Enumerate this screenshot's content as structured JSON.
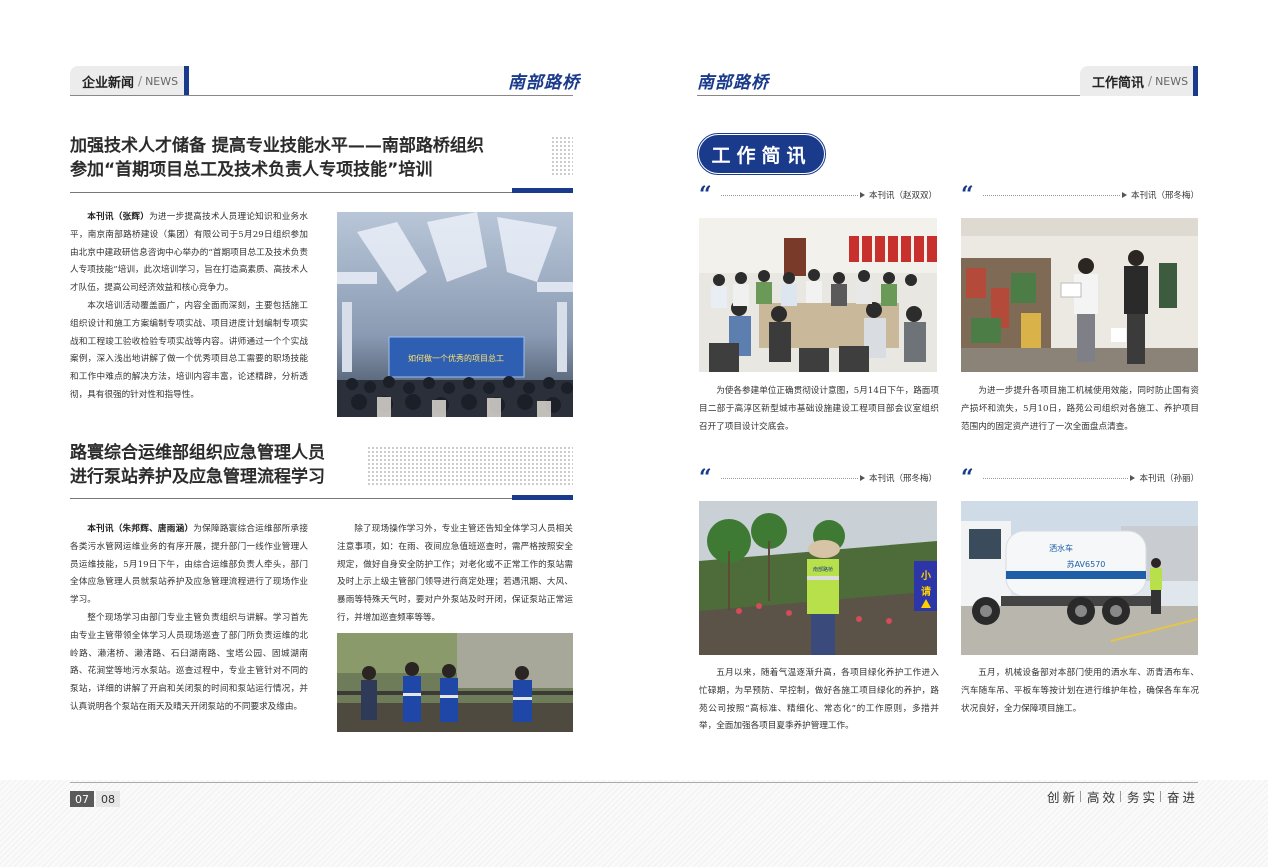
{
  "left": {
    "section": {
      "cn": "企业新闻",
      "slash": "/",
      "en": "NEWS"
    },
    "logo": "南部路桥",
    "article1": {
      "title_line1": "加强技术人才储备 提高专业技能水平——南部路桥组织",
      "title_line2": "参加“首期项目总工及技术负责人专项技能”培训",
      "byline": "本刊讯（张辉）",
      "p1": "为进一步提高技术人员理论知识和业务水平，南京南部路桥建设（集团）有限公司于5月29日组织参加由北京中建政研信息咨询中心举办的“首期项目总工及技术负责人专项技能”培训，此次培训学习，旨在打造高素质、高技术人才队伍，提高公司经济效益和核心竞争力。",
      "p2": "本次培训活动覆盖面广，内容全面而深刻，主要包括施工组织设计和施工方案编制专项实战、项目进度计划编制专项实战和工程竣工验收检验专项实战等内容。讲师通过一个个实战案例，深入浅出地讲解了做一个优秀项目总工需要的职场技能和工作中难点的解决方法，培训内容丰富，论述精辟，分析透彻，具有很强的针对性和指导性。",
      "screen_text": "如何做一个优秀的项目总工"
    },
    "article2": {
      "title_line1": "路寰综合运维部组织应急管理人员",
      "title_line2": "进行泵站养护及应急管理流程学习",
      "byline": "本刊讯（朱邦辉、唐雨涵）",
      "p1": "为保障路寰综合运维部所承接各类污水管网运维业务的有序开展，提升部门一线作业管理人员运维技能，5月19日下午，由综合运维部负责人牵头，部门全体应急管理人员就泵站养护及应急管理流程进行了现场作业学习。",
      "p2": "整个现场学习由部门专业主管负责组织与讲解。学习首先由专业主管带领全体学习人员现场巡查了部门所负责运维的北岭路、濑渚桥、濑渚路、石臼湖南路、宝塔公园、固城湖南路、花涧堂等地污水泵站。巡查过程中，专业主管针对不同的泵站，详细的讲解了开启和关闭泵的时间和泵站运行情况，并认真说明各个泵站在雨天及晴天开闭泵站的不同要求及缘由。",
      "p3": "除了现场操作学习外，专业主管还告知全体学习人员相关注意事项，如：在雨、夜间应急值班巡查时，需严格按照安全规定，做好自身安全防护工作；对老化或不正常工作的泵站需及时上示上级主管部门领导进行商定处理；若遇汛期、大风、暴雨等特殊天气时，要对户外泵站及时开闭，保证泵站正常运行，并增加巡查频率等等。"
    }
  },
  "right": {
    "logo": "南部路桥",
    "section": {
      "cn": "工作简讯",
      "slash": "/",
      "en": "NEWS"
    },
    "badge": "工作简讯",
    "quote_mark": "“",
    "items": [
      {
        "byline": "本刊讯（赵双双）",
        "text": "为使各参建单位正确贯彻设计意图，5月14日下午，路面项目二部于高淳区新型城市基础设施建设工程项目部会议室组织召开了项目设计交底会。"
      },
      {
        "byline": "本刊讯（邢冬梅）",
        "text": "为进一步提升各项目施工机械使用效能，同时防止国有资产损坏和流失，5月10日，路苑公司组织对各施工、养护项目范围内的固定资产进行了一次全面盘点清查。"
      },
      {
        "byline": "本刊讯（邢冬梅）",
        "text": "五月以来，随着气温逐渐升高，各项目绿化养护工作进入忙碌期，为早预防、早控制，做好各施工项目绿化的养护，路苑公司按照“高标准、精细化、常态化”的工作原则，多措并举，全面加强各项目夏季养护管理工作。",
        "sign_text1": "小",
        "sign_text2": "请",
        "vest_text": "南部路桥"
      },
      {
        "byline": "本刊讯（孙丽）",
        "text": "五月，机械设备部对本部门使用的洒水车、沥青洒布车、汽车随车吊、平板车等按计划在进行维护年检，确保各车车况状况良好，全力保障项目施工。",
        "truck_brand": "洒水车",
        "truck_plate": "苏AV6570"
      }
    ]
  },
  "footer": {
    "page_left": "07",
    "page_right": "08",
    "slogan": [
      "创新",
      "高效",
      "务实",
      "奋进"
    ]
  },
  "colors": {
    "brand_blue": "#1a3a8c"
  }
}
